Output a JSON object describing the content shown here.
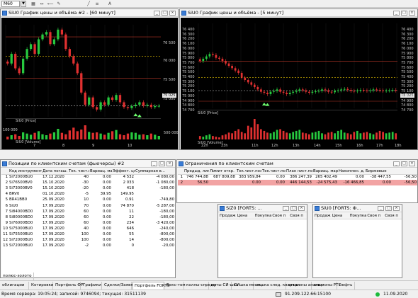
{
  "toolbar": {
    "timeframe": "M60",
    "buttons": [
      "▦",
      "↔",
      "⟵",
      "✎",
      "╱",
      "≡",
      "A"
    ]
  },
  "chart1": {
    "title": "SiU0 График цены и объёма #2 - [60 минут]",
    "price_label": "SiU0 [Price]",
    "volume_label": "SiU0 [Volume]",
    "y_ticks": [
      "76 500",
      "76 000",
      "75 500",
      "75 000"
    ],
    "vol_ticks": [
      "100 000",
      "500 000"
    ],
    "x_ticks": [
      "7",
      "8",
      "9",
      "10"
    ],
    "last_price": "75 025",
    "chart_data": {
      "type": "candlestick",
      "price_axis": [
        74800,
        76700
      ],
      "candles_close": [
        75900,
        76100,
        75800,
        75700,
        76000,
        76200,
        76300,
        76100,
        76400,
        76500,
        76550,
        76300,
        76400,
        76600,
        76500,
        76200,
        76050,
        75900,
        75700,
        75300,
        75050,
        75200,
        75000,
        74950,
        75100,
        75050,
        75200,
        75150,
        75250,
        75100,
        75000,
        74980,
        75020,
        75050,
        75100,
        75030,
        75050,
        75000,
        75020,
        75025
      ],
      "volumes": [
        12,
        18,
        22,
        15,
        30,
        25,
        20,
        28,
        35,
        22,
        18,
        25,
        30,
        45,
        28,
        22,
        38,
        50,
        35,
        42,
        60,
        32,
        28,
        30,
        25,
        20,
        28,
        35,
        40,
        22,
        18,
        25,
        30,
        28,
        20,
        22,
        18,
        25,
        20,
        15
      ]
    }
  },
  "chart2": {
    "title": "SiU0 График цены и объёма - [5 минут]",
    "price_label": "SiU0 [Price]",
    "volume_label": "SiU0 [Volume]",
    "y_ticks": [
      "76 400",
      "76 300",
      "76 200",
      "76 100",
      "76 000",
      "75 900",
      "75 800",
      "75 700",
      "75 600",
      "75 500",
      "75 400",
      "75 300",
      "75 200",
      "75 100",
      "75 000",
      "74 900",
      "74 800",
      "74 700"
    ],
    "x_ticks": [
      "22h",
      "23h",
      "11h",
      "12h",
      "13h",
      "14h",
      "15h",
      "16h",
      "17h",
      "18h"
    ],
    "last_price": "75 025",
    "chart_data": {
      "type": "candlestick",
      "price_axis": [
        74650,
        76450
      ],
      "candles_close": [
        75650,
        75700,
        75750,
        75800,
        75780,
        75720,
        75700,
        75650,
        75600,
        75550,
        75500,
        75450,
        75400,
        75300,
        75250,
        75200,
        75150,
        75100,
        75050,
        75000,
        74980,
        74950,
        75000,
        75020,
        75050,
        75000,
        74980,
        74950,
        74980,
        75000,
        75020,
        75050,
        75030,
        75000,
        74980,
        75000,
        75010,
        75020,
        75050,
        75030,
        75000,
        74990,
        75020,
        75030,
        75050,
        75060,
        75040,
        75020,
        75010,
        75025,
        75040,
        75030,
        75020,
        75030,
        75050,
        75040,
        75030,
        75020,
        75025,
        75030,
        75040,
        75025
      ],
      "volumes": [
        10,
        8,
        12,
        15,
        10,
        8,
        6,
        12,
        15,
        20,
        18,
        25,
        30,
        22,
        18,
        40,
        35,
        60,
        45,
        30,
        25,
        20,
        18,
        22,
        28,
        30,
        25,
        20,
        18,
        22,
        25,
        28,
        20,
        18,
        15,
        20,
        22,
        25,
        18,
        15,
        20,
        22,
        18,
        25,
        28,
        20,
        18,
        15,
        22,
        25,
        18,
        20,
        22,
        18,
        15,
        20,
        25,
        22,
        18,
        20,
        22,
        18
      ]
    }
  },
  "positions": {
    "title": "Позиции по клиентским счетам (фьючерсы) #2",
    "columns": [
      "Код инструмента",
      "Дата погаш.",
      "Тек. чист.поз.",
      "Вариац. маржа",
      "Эффект. цена",
      "Суммарная в..."
    ],
    "rows": [
      [
        "1",
        "Si72000BU0",
        "17.12.2020",
        "40",
        "0.00",
        "4 532",
        "-4 080,00"
      ],
      [
        "2",
        "Si76500BV0",
        "15.10.2020",
        "-30",
        "0.00",
        "2 033",
        "-1 080,00"
      ],
      [
        "3",
        "Si73000BV0",
        "15.10.2020",
        "-20",
        "0.00",
        "418",
        "-180,00"
      ],
      [
        "4",
        "BRV0",
        "01.10.2020",
        "-5",
        "39.95",
        "149.95",
        ""
      ],
      [
        "5",
        "BR41BB0",
        "25.09.2020",
        "10",
        "0.00",
        "0.91",
        "-749,80"
      ],
      [
        "6",
        "SiU0",
        "17.09.2020",
        "70",
        "0.00",
        "74 870",
        "-5 287,00"
      ],
      [
        "7",
        "Si84000BD0",
        "17.09.2020",
        "60",
        "0.00",
        "11",
        "-180,00"
      ],
      [
        "8",
        "Si80000BD0",
        "17.09.2020",
        "60",
        "0.00",
        "22",
        "-180,00"
      ],
      [
        "9",
        "Si76000BD0",
        "17.09.2020",
        "60",
        "0.00",
        "234",
        "-3 420,00"
      ],
      [
        "10",
        "Si75000BU0",
        "17.09.2020",
        "40",
        "0.00",
        "646",
        "-240,00"
      ],
      [
        "11",
        "Si75500BU0",
        "17.09.2020",
        "100",
        "0.00",
        "55",
        "-800,00"
      ],
      [
        "12",
        "Si72000BU0",
        "17.09.2020",
        "100",
        "0.00",
        "14",
        "-800,00"
      ],
      [
        "13",
        "Si72000BU0",
        "17.09.2020",
        "-2",
        "0.00",
        "0",
        "-20,00"
      ]
    ]
  },
  "limits": {
    "title": "Ограничения по клиентским счетам",
    "columns": [
      "",
      "Предыд. лим.",
      "Лимит откр. п.",
      "Тек.чист.поз.",
      "Тек.чист.поз. (",
      "План.чист.поз.",
      "Вариац. маржа",
      "Накоплен. д.",
      "Биржевые"
    ],
    "rows": [
      [
        "1",
        "746 744,88",
        "687 809,88",
        "383 959,84",
        "0.00",
        "386 247,39",
        "265 402,49",
        "0.00",
        "-38 447,55",
        "-56,50"
      ],
      [
        "2",
        "56,50",
        "",
        "0.00",
        "0.00",
        "446 144,53",
        "-24 575,43",
        "-16 466,85",
        "0.00",
        "-56,50"
      ]
    ]
  },
  "quotes1": {
    "title": "SiZ0 [FORTS: ...",
    "columns": [
      "Продаж",
      "Цена",
      "Покупка",
      "Своя п",
      "Своя п"
    ]
  },
  "quotes2": {
    "title": "SiU0 [FORTS: Ф...",
    "columns": [
      "Продаж",
      "Цена",
      "Покупка",
      "Своя п",
      "Своя п"
    ]
  },
  "tabs": {
    "top_tab": "полюс-золото",
    "items": [
      "облигации",
      "Котировки",
      "Портфель ФР",
      "Графики",
      "Сделки/Заявки",
      "Портфель FORTS",
      "Бекс-том",
      "коллы-спреды",
      "путы СИ-шка",
      "СИшка месяц",
      "сишка след. квартал",
      "опционы анализ",
      "опционы РТС",
      "нефть"
    ],
    "active": "Портфель FORTS"
  },
  "status": {
    "server_time_label": "Время сервера: 19:05:24; записей: 9746094; текущая: 31511139",
    "ip": "91.209.122.66:15100",
    "date": "11.09.2020"
  }
}
